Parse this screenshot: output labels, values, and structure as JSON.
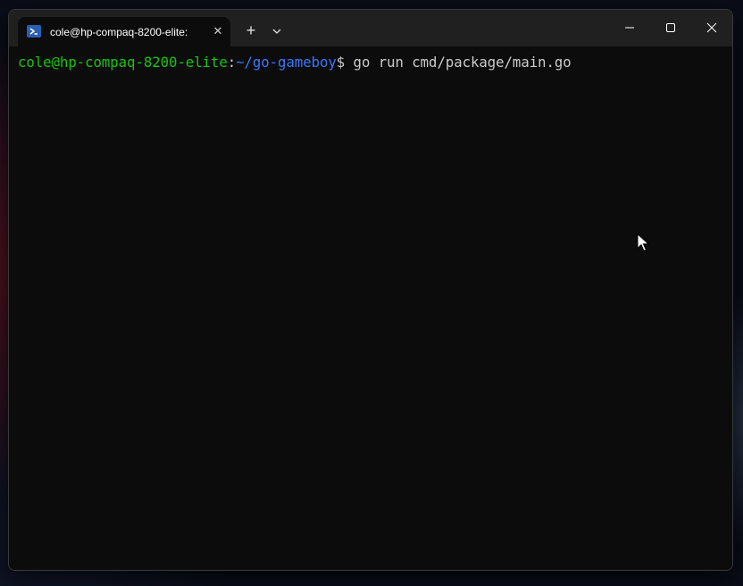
{
  "window": {
    "tab_title": "cole@hp-compaq-8200-elite:",
    "new_tab_label": "+",
    "close_tab_label": "✕"
  },
  "terminal": {
    "prompt_user_host": "cole@hp-compaq-8200-elite",
    "prompt_colon": ":",
    "prompt_path": "~/go-gameboy",
    "prompt_symbol": "$",
    "command": " go run cmd/package/main.go"
  },
  "colors": {
    "terminal_bg": "#0c0c0c",
    "titlebar_bg": "#202020",
    "prompt_user": "#16c60c",
    "prompt_path": "#3b78ff",
    "text": "#cccccc"
  },
  "icons": {
    "tab": "powershell-icon",
    "dropdown": "chevron-down-icon",
    "minimize": "minimize-icon",
    "maximize": "maximize-icon",
    "close": "close-icon",
    "pointer": "mouse-pointer-icon"
  }
}
